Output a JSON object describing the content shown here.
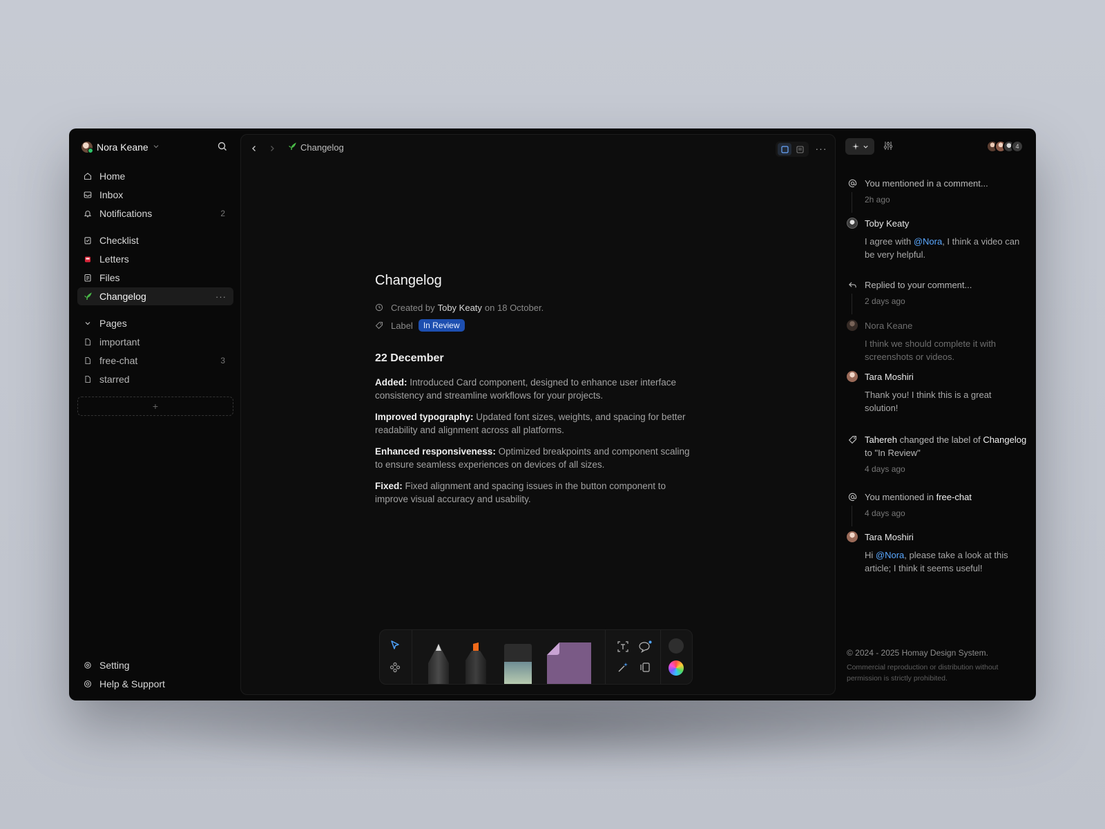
{
  "user": {
    "name": "Nora Keane"
  },
  "sidebar": {
    "main_items": [
      {
        "label": "Home",
        "icon": "home-icon"
      },
      {
        "label": "Inbox",
        "icon": "inbox-icon"
      },
      {
        "label": "Notifications",
        "icon": "bell-icon",
        "count": "2"
      }
    ],
    "workspace_items": [
      {
        "label": "Checklist",
        "icon": "checklist-icon"
      },
      {
        "label": "Letters",
        "icon": "mailbox-icon"
      },
      {
        "label": "Files",
        "icon": "file-icon"
      },
      {
        "label": "Changelog",
        "icon": "sprout-icon",
        "active": true
      }
    ],
    "pages_header": "Pages",
    "pages": [
      {
        "label": "important"
      },
      {
        "label": "free-chat",
        "count": "3"
      },
      {
        "label": "starred"
      }
    ],
    "add_label": "+",
    "bottom_items": [
      {
        "label": "Setting",
        "icon": "gear-icon"
      },
      {
        "label": "Help & Support",
        "icon": "help-icon"
      }
    ]
  },
  "topbar": {
    "breadcrumb": "Changelog"
  },
  "doc": {
    "title": "Changelog",
    "created_prefix": "Created by",
    "created_author": "Toby Keaty",
    "created_suffix": "on 18 October.",
    "label_text": "Label",
    "label_badge": "In Review",
    "date_heading": "22 December",
    "entries": [
      {
        "lead": "Added:",
        "text": "Introduced Card component, designed to enhance user interface consistency and streamline workflows for your projects."
      },
      {
        "lead": "Improved typography:",
        "text": "Updated font sizes, weights, and spacing for better readability and alignment across all platforms."
      },
      {
        "lead": "Enhanced responsiveness:",
        "text": "Optimized breakpoints and component scaling to ensure seamless experiences on devices of all sizes."
      },
      {
        "lead": "Fixed:",
        "text": "Fixed alignment and spacing issues in the button component to improve visual accuracy and usability."
      }
    ]
  },
  "feed": {
    "mention1": {
      "text": "You mentioned in a comment...",
      "time": "2h ago"
    },
    "comment1": {
      "name": "Toby Keaty",
      "pre": "I agree with ",
      "mention": "@Nora",
      "post": ", I think a video can be very helpful."
    },
    "reply1": {
      "text": "Replied to your comment...",
      "time": "2 days ago"
    },
    "comment2": {
      "name": "Nora Keane",
      "body": "I think we should complete it with screenshots or videos."
    },
    "comment3": {
      "name": "Tara Moshiri",
      "body": "Thank you! I think this is a great solution!"
    },
    "label_change": {
      "actor": "Tahereh",
      "mid": " changed the label of ",
      "doc": "Changelog",
      "post": " to \"In Review\"",
      "time": "4 days ago"
    },
    "mention2": {
      "pre": "You mentioned in ",
      "page": "free-chat",
      "time": "4 days ago"
    },
    "comment4": {
      "name": "Tara Moshiri",
      "pre": "Hi ",
      "mention": "@Nora",
      "post": ", please take a look at this article; I think it seems useful!"
    }
  },
  "presence": {
    "extra_count": "4"
  },
  "footer": {
    "copyright": "© 2024 - 2025 Homay Design System.",
    "legal": "Commercial reproduction or distribution without permission is strictly prohibited."
  },
  "colors": {
    "accent": "#5aa8ff",
    "badge": "#1d4fb0",
    "online": "#2fc46a",
    "sprout": "#4cc24a"
  }
}
